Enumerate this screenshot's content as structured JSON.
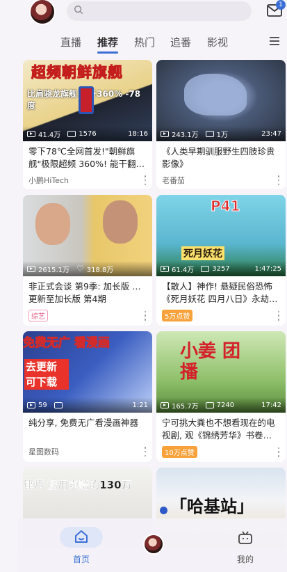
{
  "header": {
    "search_placeholder": "",
    "mail_badge": "1"
  },
  "tabs": [
    {
      "label": "直播"
    },
    {
      "label": "推荐"
    },
    {
      "label": "热门"
    },
    {
      "label": "追番"
    },
    {
      "label": "影视"
    }
  ],
  "cards": [
    {
      "thumb_text": "超频朝鲜旗舰",
      "thumb_sub": "比肩骁龙旗舰  提升360%  -78度",
      "views": "41.4万",
      "second_stat": "1576",
      "duration": "18:16",
      "title": "零下78℃全网首发!\"朝鲜旗舰\"极限超频 360%! 能干翻…",
      "uploader": "小鹏HiTech"
    },
    {
      "thumb_text": "",
      "views": "243.1万",
      "second_stat": "1万",
      "duration": "23:47",
      "title": "《人类早期驯服野生四肢珍贵影像》",
      "uploader": "老番茄"
    },
    {
      "thumb_text": "",
      "views": "2615.1万",
      "second_stat": "318.8万",
      "duration": "",
      "title": "非正式会谈 第9季: 加长版 …",
      "subtitle": "更新至加长版 第4期",
      "tag": "综艺"
    },
    {
      "thumb_text": "P41",
      "thumb_sub": "死月妖花",
      "views": "61.4万",
      "second_stat": "3257",
      "duration": "1:47:25",
      "title": "【散人】神作! 悬疑民俗恐怖《死月妖花 四月八日》永劫…",
      "tag": "5万点赞"
    },
    {
      "thumb_text": "免费无广 看漫画",
      "thumb_sub": "去更新 可下载",
      "views": "59",
      "second_stat": "",
      "duration": "1:21",
      "title": "纯分享, 免费无广看漫画神器",
      "uploader": "星图数码"
    },
    {
      "thumb_text": "小姜 团播",
      "views": "165.7万",
      "second_stat": "7240",
      "duration": "17:42",
      "title": "宁可挑大粪也不想看现在的电视剧, 观《锦绣芳华》书卷…",
      "tag": "10万点赞"
    },
    {
      "thumb_text": "律师 挪用索赔的130万",
      "views": "",
      "second_stat": "",
      "duration": "",
      "title": "",
      "uploader": ""
    },
    {
      "thumb_text": "「哈基站」",
      "views": "",
      "second_stat": "",
      "duration": "",
      "title": "",
      "uploader": ""
    }
  ],
  "bottom_nav": {
    "home_label": "首页",
    "mine_label": "我的"
  },
  "colors": {
    "accent": "#3b6fd6",
    "tag_pink": "#ea5a87",
    "tag_orange": "#f7a23b"
  }
}
